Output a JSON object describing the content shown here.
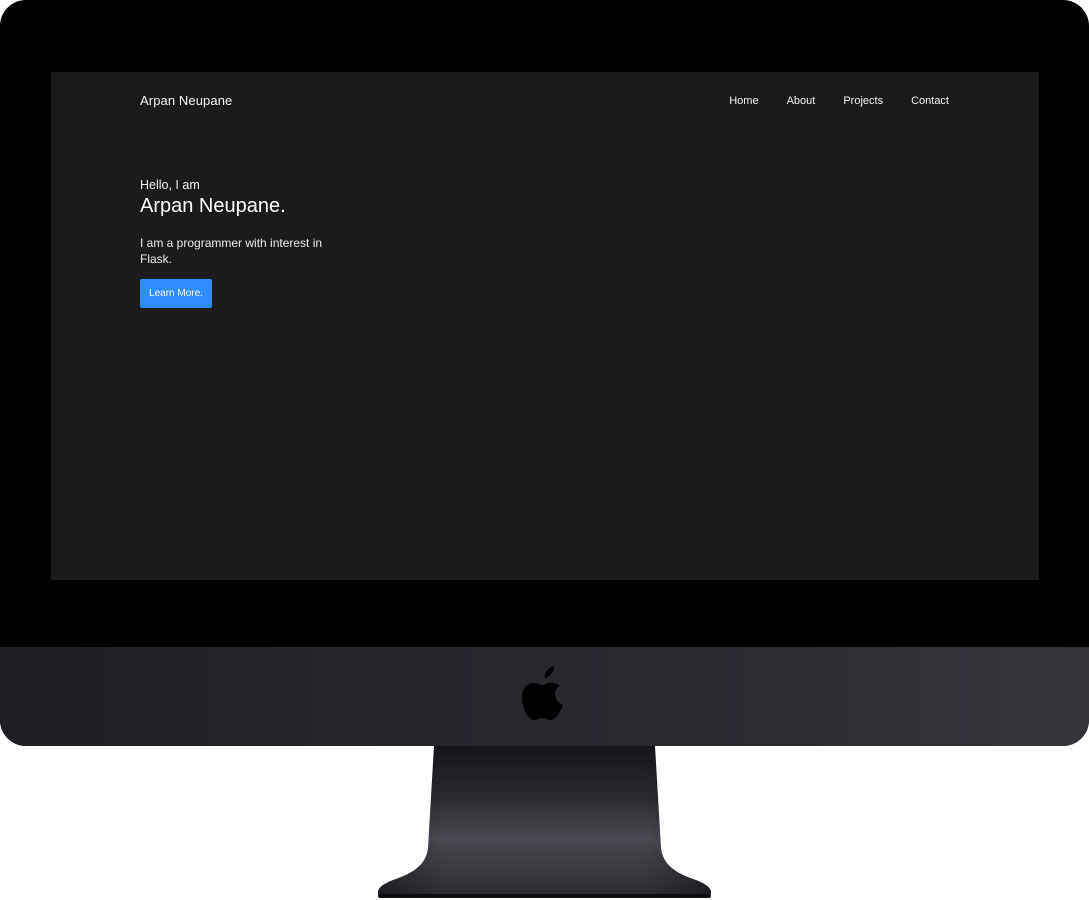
{
  "site": {
    "brand": "Arpan Neupane",
    "nav": {
      "items": [
        {
          "label": "Home"
        },
        {
          "label": "About"
        },
        {
          "label": "Projects"
        },
        {
          "label": "Contact"
        }
      ]
    },
    "hero": {
      "greeting": "Hello, I am",
      "name": "Arpan Neupane.",
      "description": "I am a programmer with interest in Flask.",
      "button_label": "Learn More."
    },
    "colors": {
      "background": "#1b1b1c",
      "accent": "#2f8cff",
      "text": "#ffffff"
    }
  },
  "device": {
    "logo_icon": "apple-logo-icon"
  }
}
